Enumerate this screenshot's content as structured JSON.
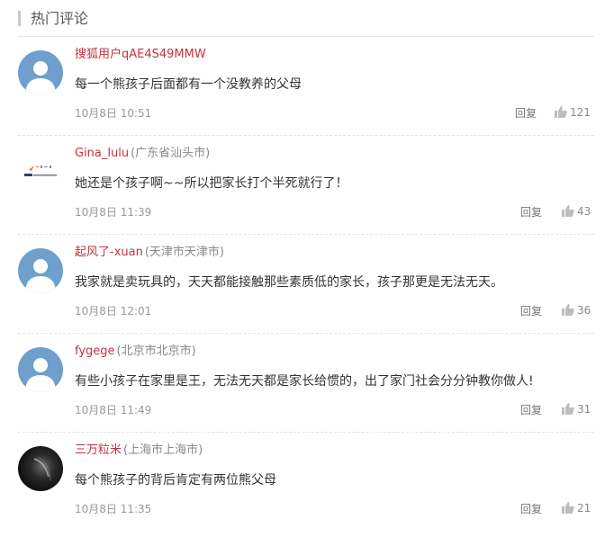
{
  "header": {
    "title": "热门评论"
  },
  "comments": [
    {
      "username": "搜狐用户qAE4S49MMW",
      "location": "",
      "content": "每一个熊孩子后面都有一个没教养的父母",
      "time": "10月8日 10:51",
      "reply_label": "回复",
      "likes": "121",
      "avatar": "default-avatar"
    },
    {
      "username": "Gina_lulu",
      "location": "(广东省汕头市)",
      "content": "她还是个孩子啊~~所以把家长打个半死就行了！",
      "time": "10月8日 11:39",
      "reply_label": "回复",
      "likes": "43",
      "avatar": "logo-avatar"
    },
    {
      "username": "起风了-xuan",
      "location": "(天津市天津市)",
      "content": "我家就是卖玩具的，天天都能接触那些素质低的家长，孩子那更是无法无天。",
      "time": "10月8日 12:01",
      "reply_label": "回复",
      "likes": "36",
      "avatar": "default-avatar"
    },
    {
      "username": "fygege",
      "location": "(北京市北京市)",
      "content": "有些小孩子在家里是王，无法无天都是家长给惯的，出了家门社会分分钟教你做人!",
      "time": "10月8日 11:49",
      "reply_label": "回复",
      "likes": "31",
      "avatar": "default-avatar"
    },
    {
      "username": "三万粒米",
      "location": "(上海市上海市)",
      "content": "每个熊孩子的背后肯定有两位熊父母",
      "time": "10月8日 11:35",
      "reply_label": "回复",
      "likes": "21",
      "avatar": "photo-avatar"
    }
  ],
  "colors": {
    "username": "#c4323e",
    "avatar_bg": "#6e9fcd"
  }
}
